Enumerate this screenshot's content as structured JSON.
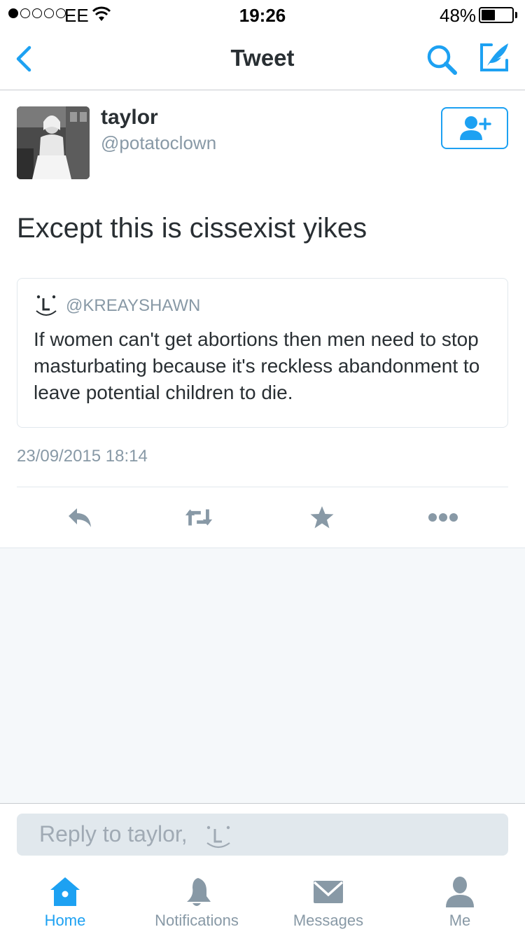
{
  "status_bar": {
    "carrier": "EE",
    "time": "19:26",
    "battery_percent": "48%",
    "battery_level": 0.48,
    "signal_bars_filled": 1,
    "signal_bars_total": 5
  },
  "nav": {
    "title": "Tweet",
    "back_icon": "chevron-left-icon",
    "search_icon": "search-icon",
    "compose_icon": "compose-icon"
  },
  "tweet": {
    "author_name": "taylor",
    "author_handle": "@potatoclown",
    "follow_icon": "add-user-icon",
    "text": "Except this is cissexist yikes",
    "timestamp": "23/09/2015 18:14",
    "quoted": {
      "handle": "@KREAYSHAWN",
      "text": "If women can't get abortions then men need to stop masturbating because it's reckless abandonment to leave potential children to die."
    }
  },
  "actions": {
    "reply_icon": "reply-icon",
    "retweet_icon": "retweet-icon",
    "favorite_icon": "star-icon",
    "more_icon": "more-icon"
  },
  "reply_box": {
    "placeholder": "Reply to taylor,"
  },
  "tabs": [
    {
      "label": "Home",
      "icon": "home-icon",
      "active": true
    },
    {
      "label": "Notifications",
      "icon": "bell-icon",
      "active": false
    },
    {
      "label": "Messages",
      "icon": "envelope-icon",
      "active": false
    },
    {
      "label": "Me",
      "icon": "person-icon",
      "active": false
    }
  ],
  "colors": {
    "accent": "#1da1f2",
    "text": "#292f33",
    "muted": "#8899a6",
    "background_alt": "#f5f8fa"
  }
}
